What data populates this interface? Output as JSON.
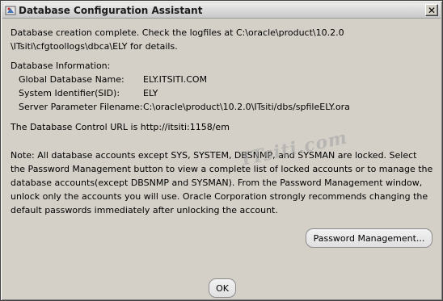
{
  "window": {
    "title": "Database Configuration Assistant",
    "close_symbol": "✕"
  },
  "message": {
    "line1": "Database creation complete. Check the logfiles at C:\\oracle\\product\\10.2.0",
    "line2": "\\ITsiti\\cfgtoollogs\\dbca\\ELY for details.",
    "info_heading": "Database Information:",
    "info": [
      {
        "label": "Global Database Name:",
        "value": "ELY.ITSITI.COM"
      },
      {
        "label": "System Identifier(SID):",
        "value": "ELY"
      },
      {
        "label": "Server Parameter Filename:",
        "value": "C:\\oracle\\product\\10.2.0\\ITsiti/dbs/spfileELY.ora"
      }
    ],
    "control_url": "The Database Control URL is http://itsiti:1158/em",
    "note_lines": [
      "Note: All database accounts except SYS, SYSTEM, DBSNMP, and SYSMAN are locked. Select",
      "the Password Management button to view a complete list of locked accounts or to manage the",
      "database accounts(except DBSNMP and SYSMAN). From the Password Management window,",
      "unlock only the accounts you will use. Oracle Corporation strongly recommends changing the",
      "default passwords immediately after unlocking the account."
    ]
  },
  "watermark": "ITsiti.com",
  "buttons": {
    "password_management": "Password Management...",
    "ok": "OK"
  },
  "icons": {
    "app": "oracle-dbca-icon",
    "close": "close-icon"
  }
}
